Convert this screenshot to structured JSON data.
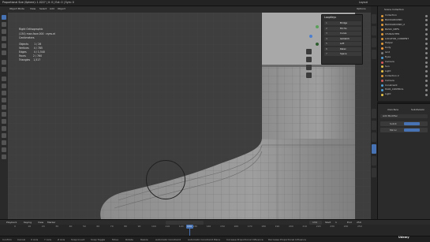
{
  "window": {
    "title": "Proportional Size (Sphere): 1.0227 | X: 0 | Ext: 0 | Sym: 0",
    "mode_tab": "Layout"
  },
  "viewport": {
    "header_items": [
      "Object Mode",
      "View",
      "Select",
      "Add",
      "Object"
    ],
    "options_label": "Options",
    "info": {
      "projection": "Right Orthographic",
      "collection_line": "(134) man.face.000 : eyes.eI",
      "unit_line": "Centimeters",
      "stats": [
        {
          "label": "Objects",
          "value": "1 / 26"
        },
        {
          "label": "Vertices",
          "value": "4 / 785"
        },
        {
          "label": "Edges",
          "value": "4 / 1,540"
        },
        {
          "label": "Faces",
          "value": "2 / 760"
        },
        {
          "label": "Triangles",
          "value": "1,517"
        }
      ]
    },
    "loopkey_panel": {
      "title": "LoopKeys",
      "rows": [
        {
          "num": "1",
          "label": "Bridge"
        },
        {
          "num": "2",
          "label": "Fill Ho"
        },
        {
          "num": "3",
          "label": "Curve"
        },
        {
          "num": "4",
          "label": "Gstretch"
        },
        {
          "num": "5",
          "label": "Loft"
        },
        {
          "num": "6",
          "label": "Relax"
        },
        {
          "num": "7",
          "label": "Space"
        }
      ]
    }
  },
  "outliner": {
    "header": "Scene Collection",
    "items": [
      {
        "label": "Collection",
        "color": "#e09a3a"
      },
      {
        "label": "BACKGROUND",
        "color": "#e09a3a"
      },
      {
        "label": "BACKGROUND_2",
        "color": "#e09a3a"
      },
      {
        "label": "BASIC_REFS",
        "color": "#e09a3a"
      },
      {
        "label": "CHARACTER",
        "color": "#e09a3a"
      },
      {
        "label": "LOCATOR_CURRENT",
        "color": "#e09a3a"
      },
      {
        "label": "Helper",
        "color": "#e09a3a"
      },
      {
        "label": "body",
        "color": "#ff9c3a"
      },
      {
        "label": "Grid",
        "color": "#7f7f7f"
      },
      {
        "label": "Eyes",
        "color": "#4e9fd8"
      },
      {
        "label": "Camera",
        "color": "#d65a5a"
      },
      {
        "label": "Sun",
        "color": "#e6c44a"
      },
      {
        "label": "Light",
        "color": "#e6c44a"
      },
      {
        "label": "Collection 2",
        "color": "#e09a3a"
      },
      {
        "label": "Camera",
        "color": "#d65a5a"
      },
      {
        "label": "Constraint",
        "color": "#4e9fd8"
      },
      {
        "label": "HAIR_CONTROL",
        "color": "#4e9fd8"
      },
      {
        "label": "Light",
        "color": "#e6c44a"
      }
    ]
  },
  "properties": {
    "header": "man.face",
    "subheader": "Subdivision",
    "section": "Add Modifier",
    "modifiers": [
      {
        "label": "Subdi"
      },
      {
        "label": "Mirror"
      }
    ]
  },
  "timeline": {
    "menu": [
      "Playback",
      "Keying",
      "View",
      "Marker"
    ],
    "current_frame": "134",
    "start_label": "Start",
    "start_value": "1",
    "end_label": "End",
    "end_value": "250",
    "frames": [
      "0",
      "10",
      "20",
      "30",
      "40",
      "50",
      "60",
      "70",
      "80",
      "90",
      "100",
      "110",
      "120",
      "130",
      "140",
      "150",
      "160",
      "170",
      "180",
      "190",
      "200",
      "210",
      "220",
      "230",
      "240",
      "250"
    ]
  },
  "status": {
    "items": [
      "Confirm",
      "Cancel",
      "X Axis",
      "Y Axis",
      "Z Axis",
      "Snap Invert",
      "Snap Toggle",
      "Move",
      "Rotate",
      "Resize",
      "Automatic Constraint",
      "Automatic Constraint Plane",
      "Increase Proportional Influence",
      "Decrease Proportional Influence"
    ],
    "watermark": "Udemy"
  }
}
